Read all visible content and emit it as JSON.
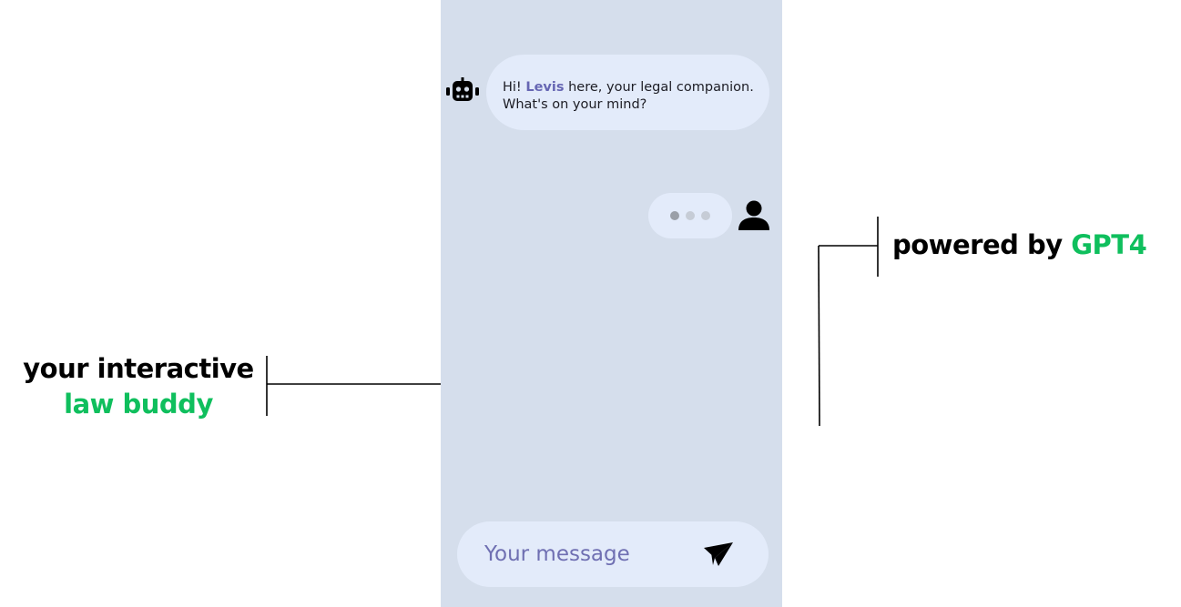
{
  "chat": {
    "bot_message": {
      "greeting": "Hi! ",
      "bot_name": "Levis",
      "rest_line1": " here, your legal companion.",
      "line2": "What's on your mind?"
    },
    "typing_indicator_dots": 3,
    "composer": {
      "placeholder": "Your message",
      "value": ""
    },
    "icons": {
      "bot": "robot-icon",
      "user": "user-icon",
      "send": "paper-plane-icon"
    }
  },
  "captions": {
    "left": {
      "line1": "your interactive",
      "line2": "law buddy"
    },
    "right": {
      "part1": "powered by ",
      "part2": "GPT4"
    }
  },
  "colors": {
    "panel_background": "#d5deec",
    "bubble_background": "#e3ebfa",
    "bot_name": "#6666b3",
    "placeholder": "#6f6fb2",
    "accent_green": "#0fbf5d",
    "dot_dark": "#9a9fa8",
    "dot_light": "#c6ccd6"
  }
}
